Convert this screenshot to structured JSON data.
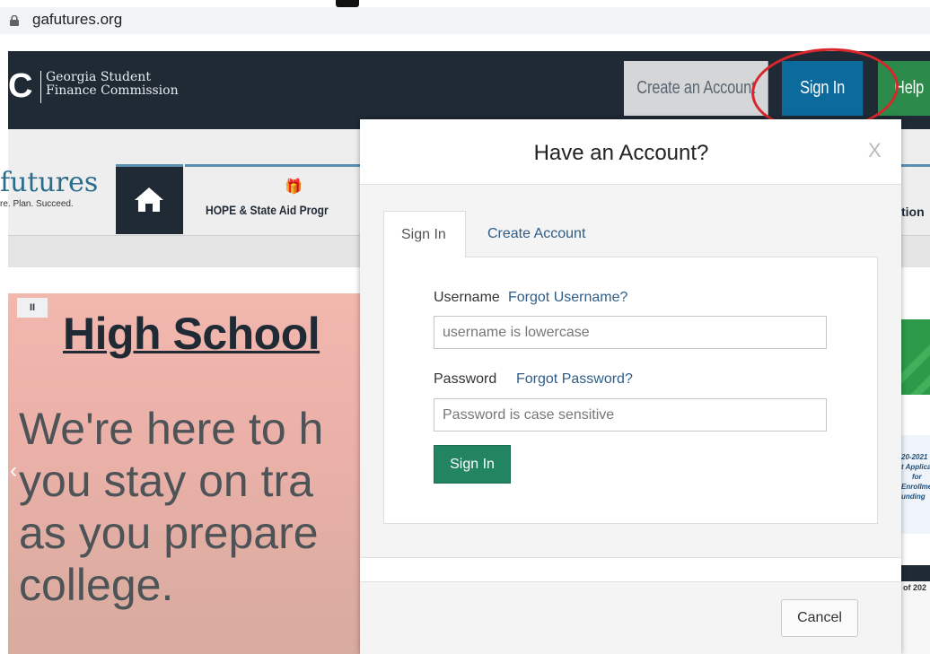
{
  "browser": {
    "url": "gafutures.org",
    "lock_icon": "lock-icon"
  },
  "header": {
    "brand_letter": "C",
    "brand_line1": "Georgia Student",
    "brand_line2": "Finance Commission",
    "create_account_label": "Create an Account",
    "sign_in_label": "Sign In",
    "help_label": "Help",
    "annotation_color": "#d9262c"
  },
  "nav": {
    "logo_text": "futures",
    "logo_tagline": "re. Plan. Succeed.",
    "home_icon": "home-icon",
    "hope_icon": "gift-icon",
    "hope_label": "HOPE & State Aid Progr",
    "right_tab_label": "tion"
  },
  "hero": {
    "pause_label": "II",
    "title": "High School",
    "body_lines": [
      "We're here to h",
      "you stay on tra",
      "as you prepare",
      "college."
    ],
    "prev_arrow": "‹"
  },
  "side_strip": {
    "flyer_lines": [
      "20-2021",
      "t Applica",
      "for",
      "Enrollme",
      "unding"
    ],
    "doc_title": "of 202"
  },
  "modal": {
    "title": "Have an Account?",
    "close_label": "X",
    "tabs": [
      {
        "label": "Sign In",
        "active": true
      },
      {
        "label": "Create Account",
        "active": false
      }
    ],
    "username_label": "Username",
    "forgot_username": "Forgot Username?",
    "username_placeholder": "username is lowercase",
    "password_label": "Password",
    "forgot_password": "Forgot Password?",
    "password_placeholder": "Password is case sensitive",
    "submit_label": "Sign In",
    "cancel_label": "Cancel",
    "submit_color": "#238462"
  }
}
